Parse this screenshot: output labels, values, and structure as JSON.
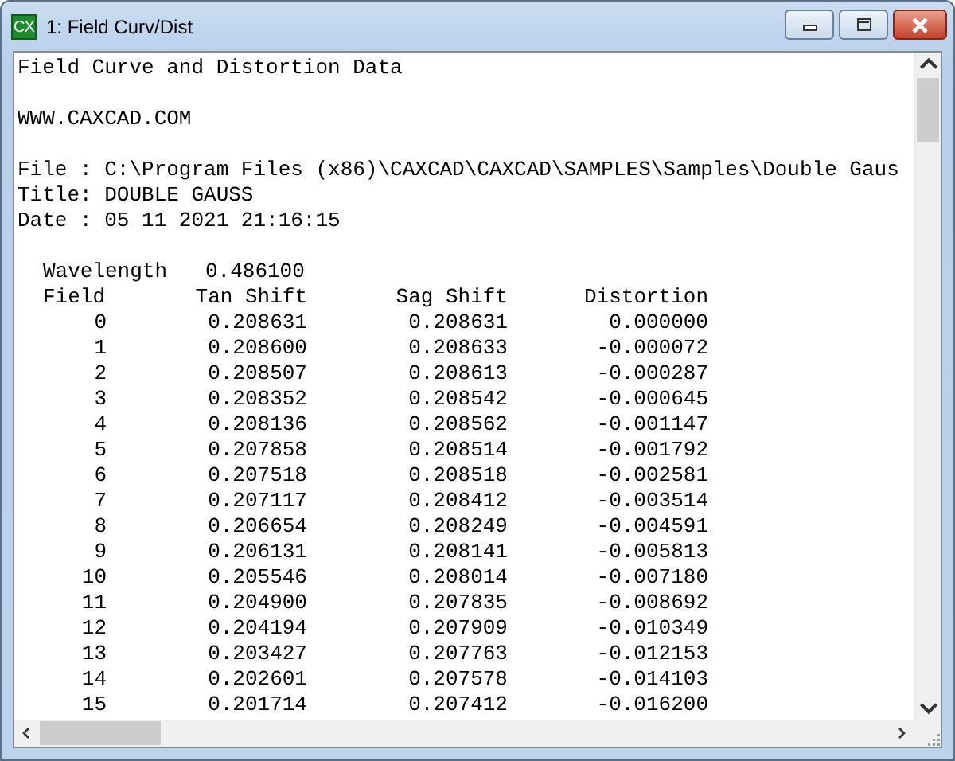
{
  "window": {
    "title": "1: Field Curv/Dist",
    "app_icon_text": "CX"
  },
  "heading": "Field Curve and Distortion Data",
  "website": "WWW.CAXCAD.COM",
  "file_info": [
    "File : C:\\Program Files (x86)\\CAXCAD\\CAXCAD\\SAMPLES\\Samples\\Double Gaus",
    "Title: DOUBLE GAUSS",
    "Date : 05 11 2021 21:16:15"
  ],
  "wavelength": {
    "label": "Wavelength",
    "value": "0.486100"
  },
  "table": {
    "columns": [
      "Field",
      "Tan Shift",
      "Sag Shift",
      "Distortion"
    ],
    "rows": [
      [
        "0",
        "0.208631",
        "0.208631",
        "0.000000"
      ],
      [
        "1",
        "0.208600",
        "0.208633",
        "-0.000072"
      ],
      [
        "2",
        "0.208507",
        "0.208613",
        "-0.000287"
      ],
      [
        "3",
        "0.208352",
        "0.208542",
        "-0.000645"
      ],
      [
        "4",
        "0.208136",
        "0.208562",
        "-0.001147"
      ],
      [
        "5",
        "0.207858",
        "0.208514",
        "-0.001792"
      ],
      [
        "6",
        "0.207518",
        "0.208518",
        "-0.002581"
      ],
      [
        "7",
        "0.207117",
        "0.208412",
        "-0.003514"
      ],
      [
        "8",
        "0.206654",
        "0.208249",
        "-0.004591"
      ],
      [
        "9",
        "0.206131",
        "0.208141",
        "-0.005813"
      ],
      [
        "10",
        "0.205546",
        "0.208014",
        "-0.007180"
      ],
      [
        "11",
        "0.204900",
        "0.207835",
        "-0.008692"
      ],
      [
        "12",
        "0.204194",
        "0.207909",
        "-0.010349"
      ],
      [
        "13",
        "0.203427",
        "0.207763",
        "-0.012153"
      ],
      [
        "14",
        "0.202601",
        "0.207578",
        "-0.014103"
      ],
      [
        "15",
        "0.201714",
        "0.207412",
        "-0.016200"
      ]
    ]
  }
}
